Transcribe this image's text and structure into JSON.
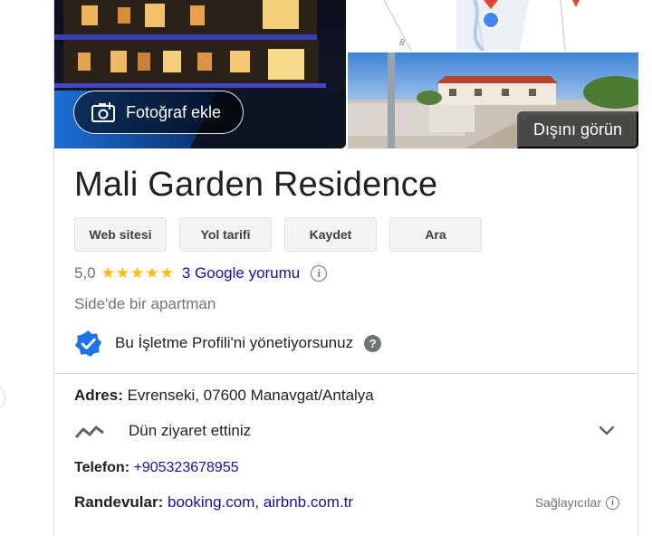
{
  "photos": {
    "add_photo_label": "Fotoğraf ekle",
    "see_outside_label": "Dışını görün",
    "map_street_label": "8"
  },
  "business": {
    "name": "Mali Garden Residence",
    "rating": "5,0",
    "stars": "★★★★★",
    "reviews_label": "3 Google yorumu",
    "info_glyph": "i",
    "category": "Side'de bir apartman",
    "owner_note": "Bu İşletme Profili'ni yönetiyorsunuz",
    "help_glyph": "?"
  },
  "actions": [
    {
      "label": "Web sitesi"
    },
    {
      "label": "Yol tarifi"
    },
    {
      "label": "Kaydet"
    },
    {
      "label": "Ara"
    }
  ],
  "details": {
    "address_label": "Adres",
    "address_value": "Evrenseki, 07600 Manavgat/Antalya",
    "visited_label": "Dün ziyaret ettiniz",
    "phone_label": "Telefon",
    "phone_value": "+905323678955",
    "appointments_label": "Randevular",
    "appointment_links": [
      "booking.com",
      "airbnb.com.tr"
    ],
    "link_separator": ", ",
    "providers_label": "Sağlayıcılar",
    "colon": ":"
  },
  "colors": {
    "link": "#1a0dab",
    "star": "#fbbc04",
    "verified": "#1a73e8",
    "muted": "#70757a"
  }
}
